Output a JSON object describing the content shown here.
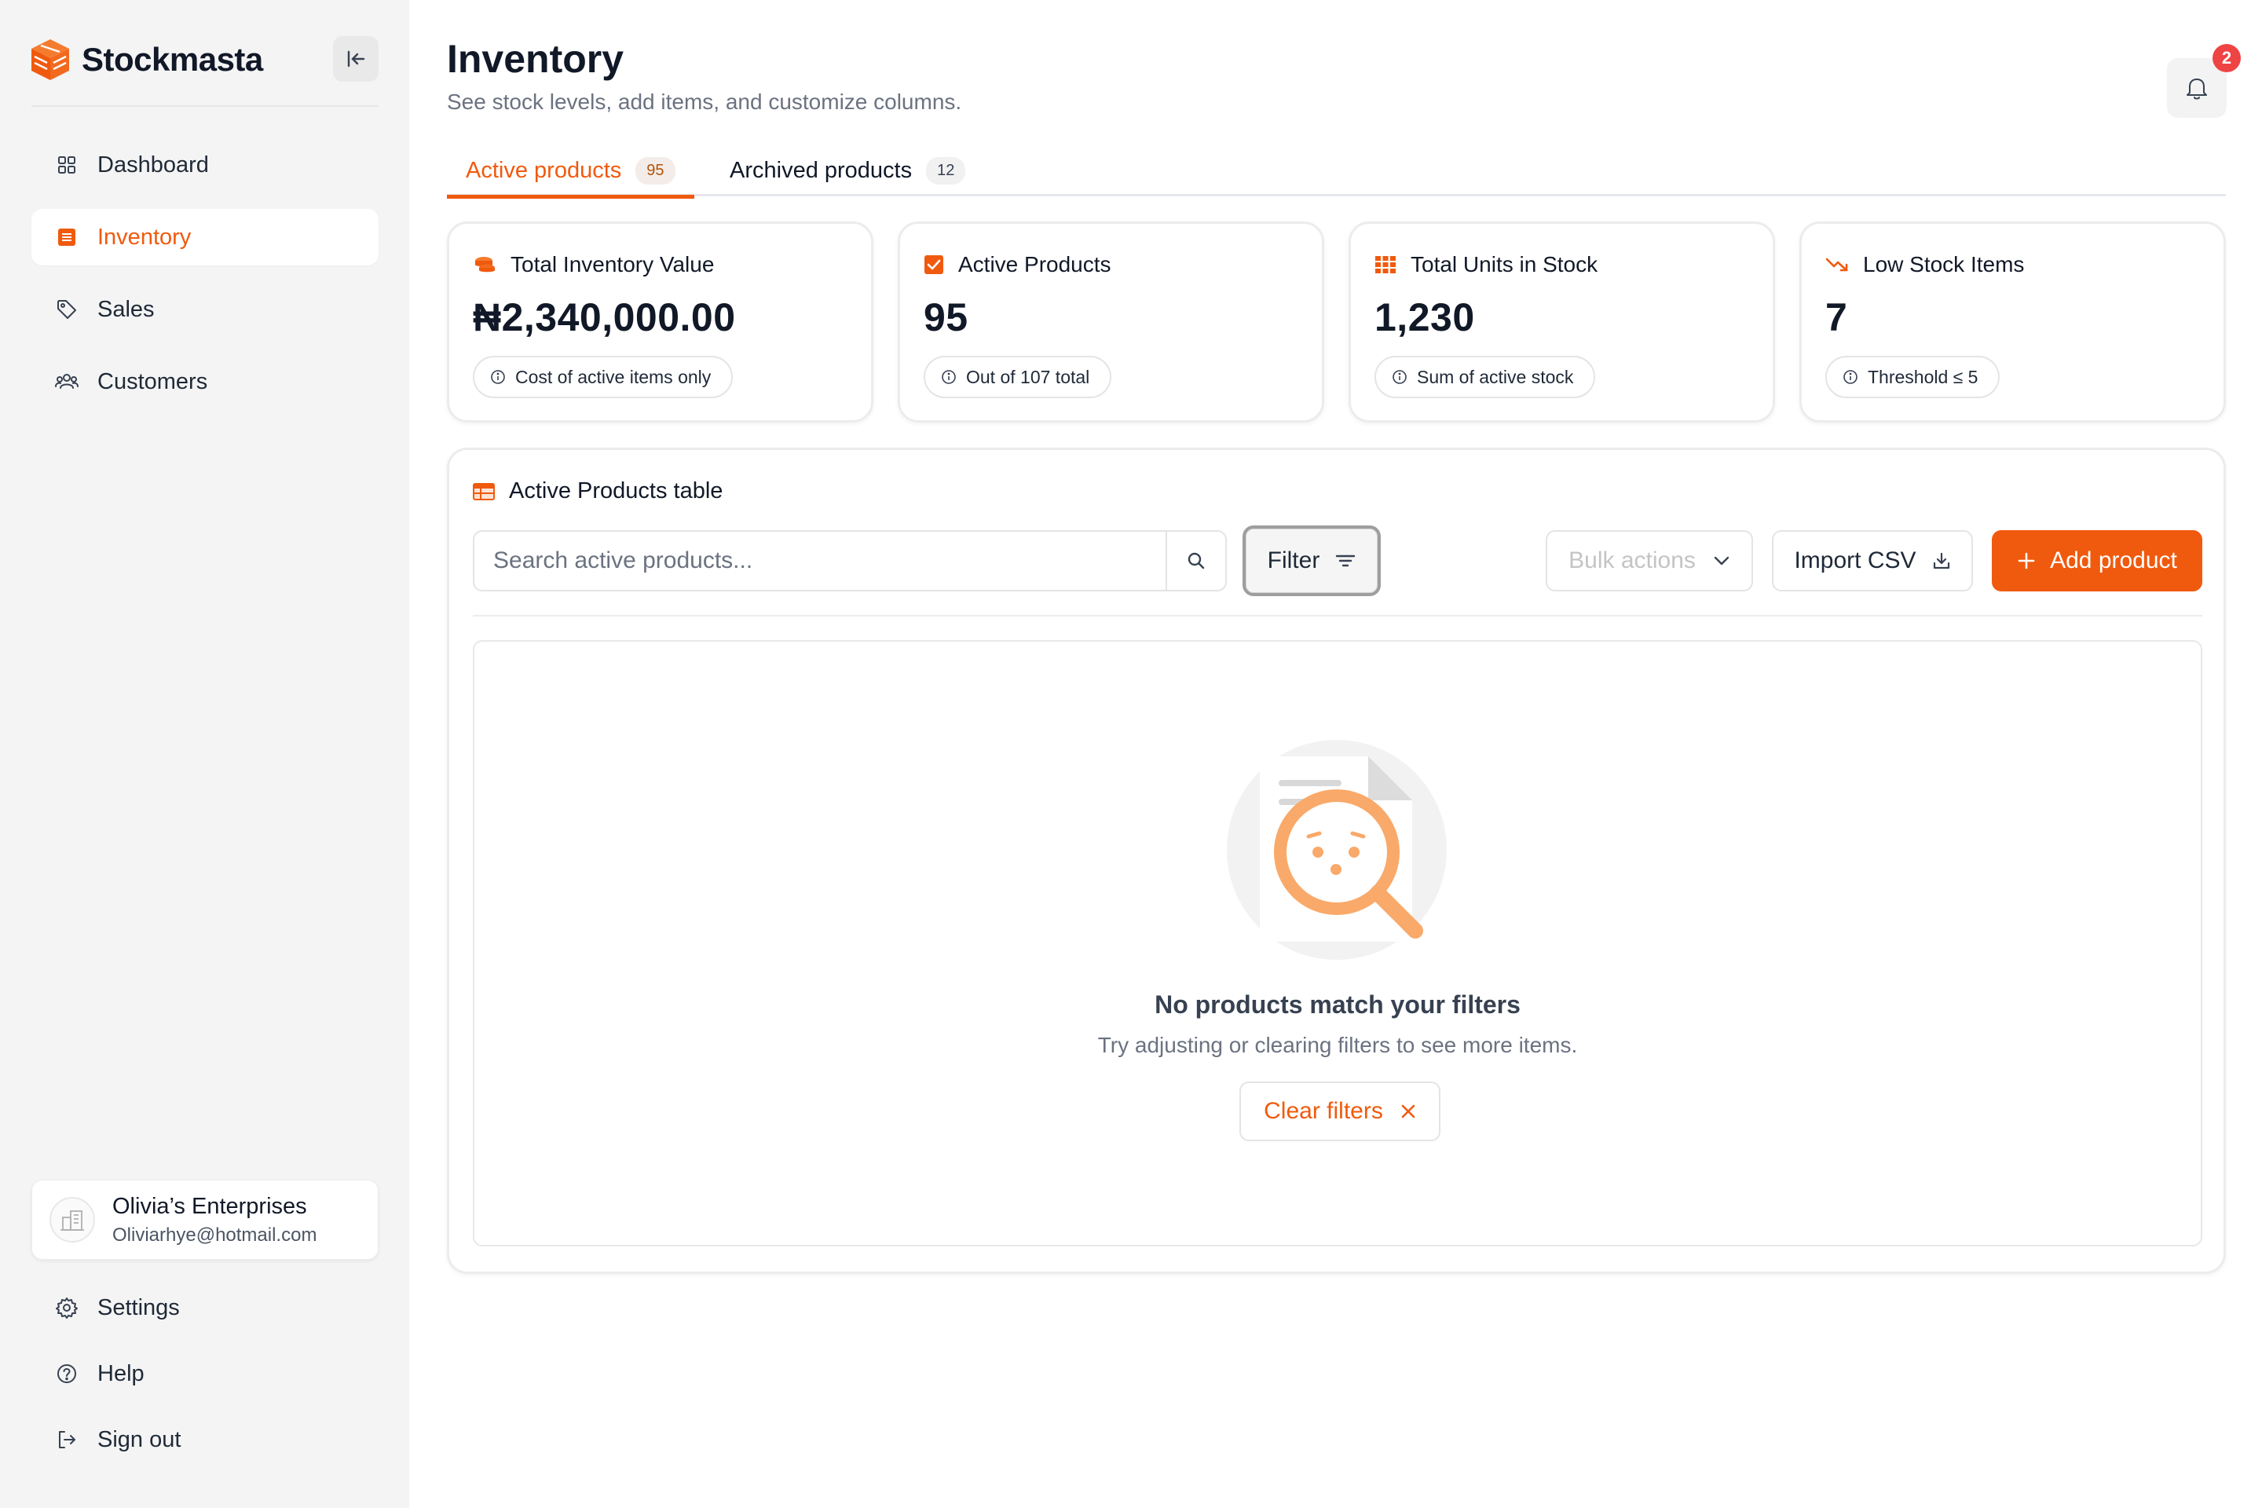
{
  "brand": {
    "name": "Stockmasta"
  },
  "sidebar": {
    "items": [
      {
        "label": "Dashboard",
        "icon": "grid-icon"
      },
      {
        "label": "Inventory",
        "icon": "list-icon",
        "active": true
      },
      {
        "label": "Sales",
        "icon": "tag-icon"
      },
      {
        "label": "Customers",
        "icon": "users-icon"
      }
    ],
    "org": {
      "name": "Olivia’s Enterprises",
      "email": "Oliviarhye@hotmail.com"
    },
    "bottom": [
      {
        "label": "Settings",
        "icon": "gear-icon"
      },
      {
        "label": "Help",
        "icon": "help-icon"
      },
      {
        "label": "Sign out",
        "icon": "sign-out-icon"
      }
    ]
  },
  "header": {
    "title": "Inventory",
    "subtitle": "See stock levels, add items, and customize columns.",
    "notifications_count": "2"
  },
  "tabs": [
    {
      "label": "Active products",
      "count": "95",
      "active": true
    },
    {
      "label": "Archived products",
      "count": "12",
      "active": false
    }
  ],
  "stats": [
    {
      "label": "Total Inventory Value",
      "value": "₦2,340,000.00",
      "note": "Cost of active items only",
      "icon": "coins-icon"
    },
    {
      "label": "Active Products",
      "value": "95",
      "note": "Out of 107 total",
      "icon": "checkbox-icon"
    },
    {
      "label": "Total Units in Stock",
      "value": "1,230",
      "note": "Sum of active stock",
      "icon": "grid-dots-icon"
    },
    {
      "label": "Low Stock Items",
      "value": "7",
      "note": "Threshold ≤ 5",
      "icon": "trend-down-icon"
    }
  ],
  "table": {
    "title": "Active Products table",
    "search_placeholder": "Search active products...",
    "filter_label": "Filter",
    "bulk_label": "Bulk actions",
    "import_label": "Import CSV",
    "add_label": "Add product",
    "empty_title": "No products match your filters",
    "empty_subtitle": "Try adjusting or clearing filters to see more items.",
    "clear_label": "Clear filters"
  },
  "colors": {
    "accent": "#f05a0e",
    "badge": "#ef4444",
    "sidebar_bg": "#f4f4f4"
  }
}
